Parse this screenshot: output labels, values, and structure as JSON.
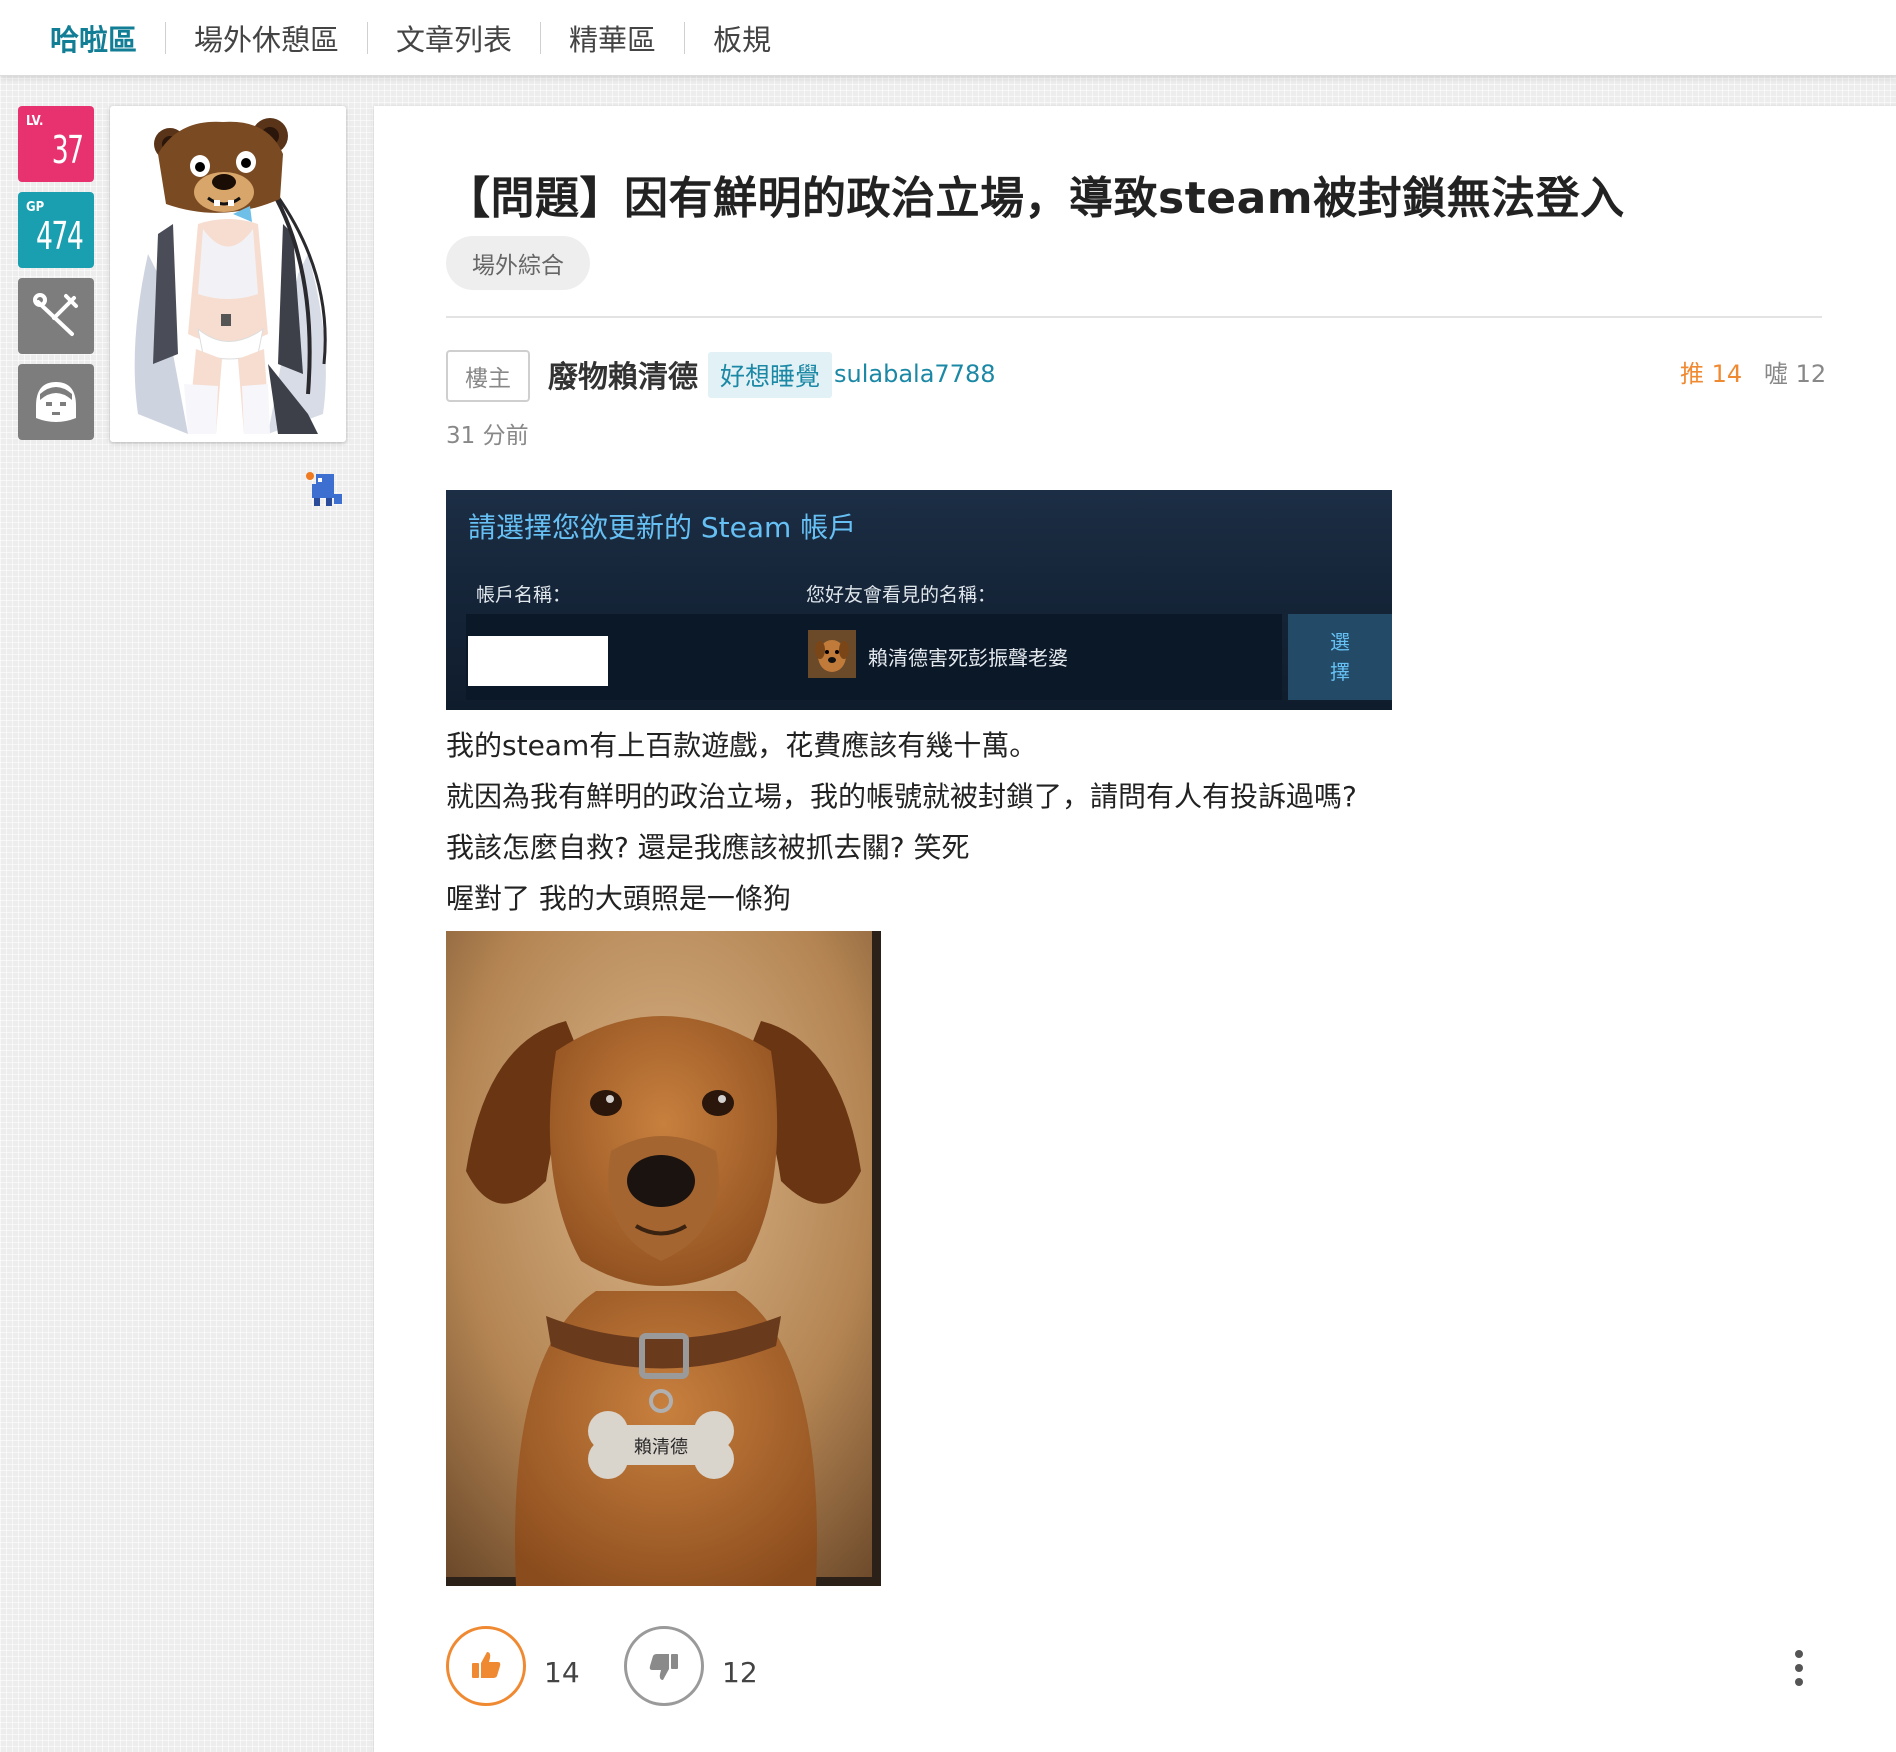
{
  "nav": {
    "items": [
      {
        "label": "哈啦區",
        "active": true
      },
      {
        "label": "場外休憩區",
        "active": false
      },
      {
        "label": "文章列表",
        "active": false
      },
      {
        "label": "精華區",
        "active": false
      },
      {
        "label": "板規",
        "active": false
      }
    ]
  },
  "profile": {
    "level_tag": "LV.",
    "level": "37",
    "gp_tag": "GP",
    "gp": "474",
    "tool_icon": "wrench-icon",
    "face_icon": "face-icon"
  },
  "post": {
    "title": "【問題】因有鮮明的政治立場，導致steam被封鎖無法登入",
    "board_tag": "場外綜合",
    "floor": "樓主",
    "author_name": "廢物賴清德",
    "author_title": "好想睡覺",
    "author_id": "sulabala7788",
    "push_label": "推 14",
    "boo_label": "噓 12",
    "time": "31 分前",
    "steam_screenshot": {
      "heading": "請選擇您欲更新的 Steam 帳戶",
      "col_account": "帳戶名稱：",
      "col_nickname": "您好友會看見的名稱：",
      "nickname": "賴清德害死彭振聲老婆",
      "select_line1": "選",
      "select_line2": "擇"
    },
    "body_lines": [
      "我的steam有上百款遊戲，花費應該有幾十萬。",
      "就因為我有鮮明的政治立場，我的帳號就被封鎖了，請問有人有投訴過嗎?",
      "我該怎麼自救? 還是我應該被抓去關? 笑死",
      "喔對了 我的大頭照是一條狗"
    ],
    "dog_tag_text": "賴清德",
    "like_count": "14",
    "dislike_count": "12"
  },
  "colors": {
    "accent": "#117e96",
    "push": "#f08a32",
    "level_badge": "#e8326f",
    "gp_badge": "#1a9fb0"
  }
}
